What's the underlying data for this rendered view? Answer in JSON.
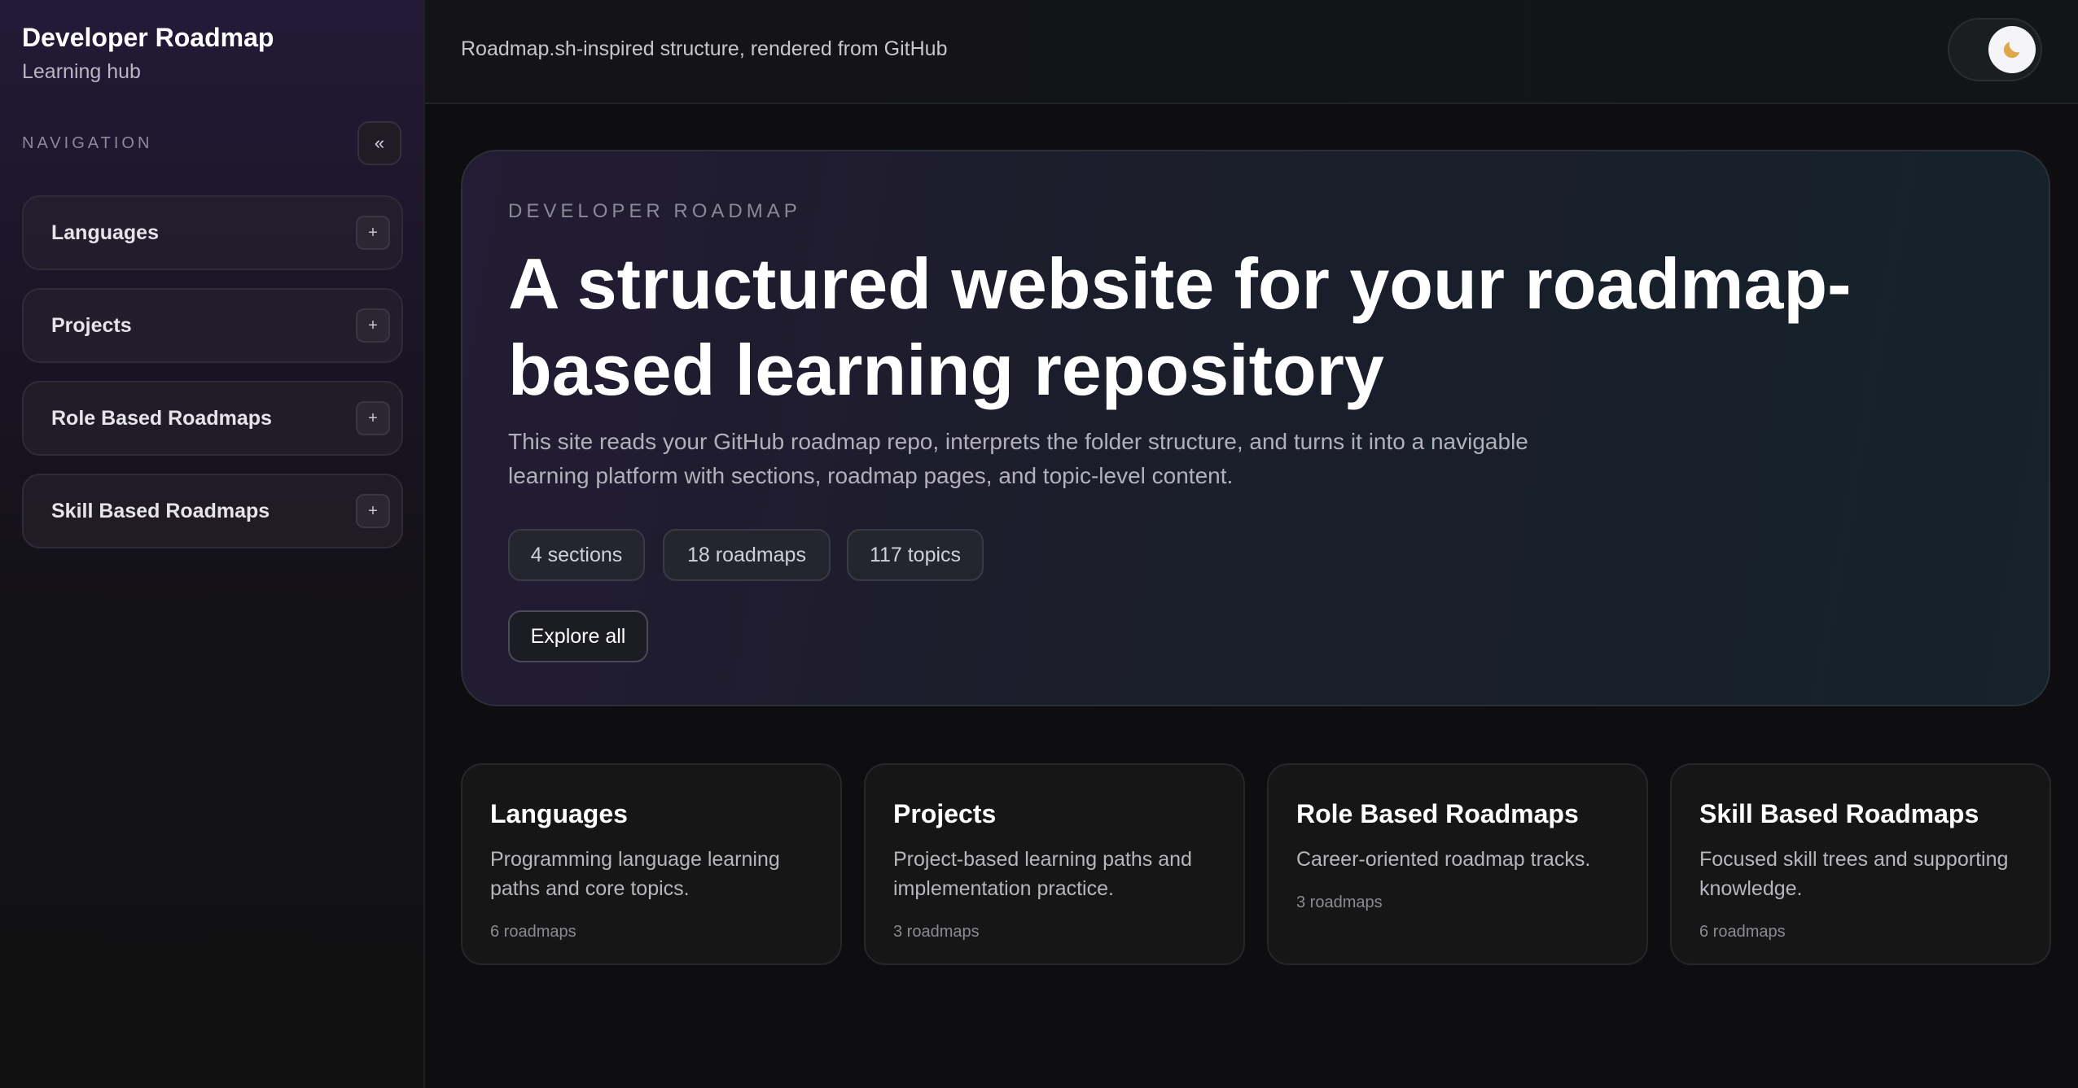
{
  "sidebar": {
    "title": "Developer Roadmap",
    "subtitle": "Learning hub",
    "nav_label": "NAVIGATION",
    "collapse_glyph": "«",
    "items": [
      {
        "label": "Languages",
        "toggle": "+"
      },
      {
        "label": "Projects",
        "toggle": "+"
      },
      {
        "label": "Role Based Roadmaps",
        "toggle": "+"
      },
      {
        "label": "Skill Based Roadmaps",
        "toggle": "+"
      }
    ]
  },
  "topbar": {
    "tagline": "Roadmap.sh-inspired structure, rendered from GitHub",
    "theme_icon": "moon-icon"
  },
  "hero": {
    "eyebrow": "DEVELOPER ROADMAP",
    "title": "A structured website for your roadmap-based learning repository",
    "description": "This site reads your GitHub roadmap repo, interprets the folder structure, and turns it into a navigable learning platform with sections, roadmap pages, and topic-level content.",
    "stats": [
      "4 sections",
      "18 roadmaps",
      "117 topics"
    ],
    "cta": "Explore all"
  },
  "cards": [
    {
      "title": "Languages",
      "description": "Programming language learning paths and core topics.",
      "count": "6 roadmaps"
    },
    {
      "title": "Projects",
      "description": "Project-based learning paths and implementation practice.",
      "count": "3 roadmaps"
    },
    {
      "title": "Role Based Roadmaps",
      "description": "Career-oriented roadmap tracks.",
      "count": "3 roadmaps"
    },
    {
      "title": "Skill Based Roadmaps",
      "description": "Focused skill trees and supporting knowledge.",
      "count": "6 roadmaps"
    }
  ],
  "colors": {
    "accent_moon": "#e0a64a",
    "background": "#0d0d0f"
  }
}
